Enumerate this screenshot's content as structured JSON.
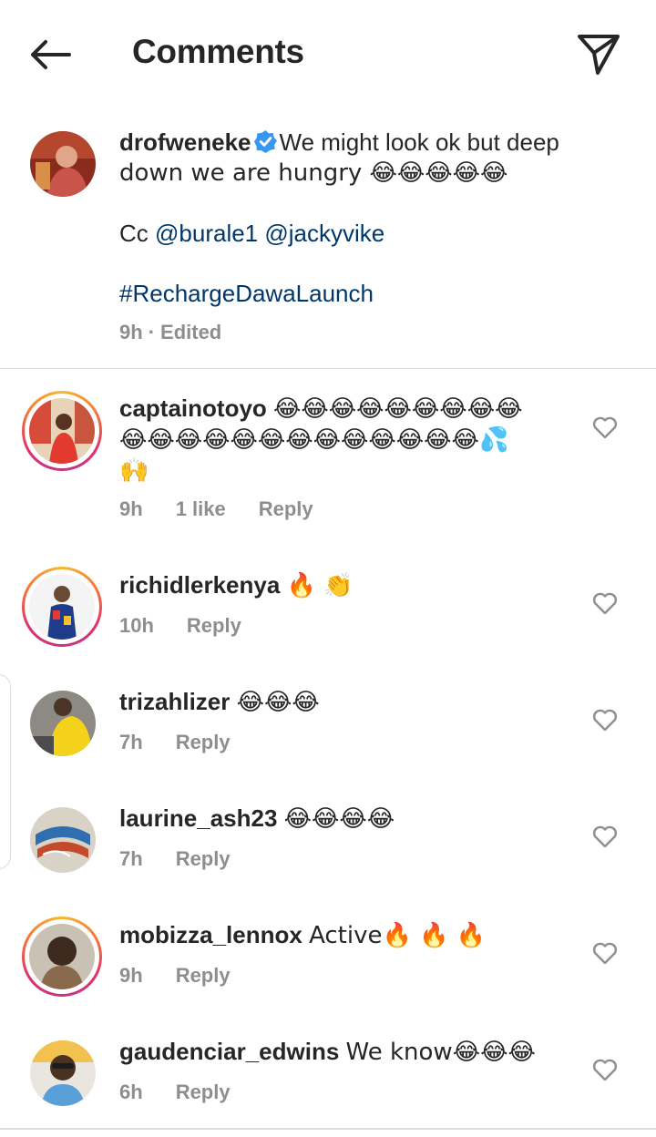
{
  "header": {
    "title": "Comments"
  },
  "caption": {
    "username": "drofweneke",
    "text_line1": "We might look ok but deep",
    "text_line2": "down we are hungry 😂😂😂😂😂",
    "cc_label": "Cc",
    "mention1": "@burale1",
    "mention2": "@jackyvike",
    "hashtag": "#RechargeDawaLaunch",
    "time": "9h",
    "separator": "·",
    "edited": "Edited"
  },
  "comments": [
    {
      "username": "captainotoyo",
      "line1": "😂😂😂😂😂😂😂😂😂",
      "line2": "😂😂😂😂😂😂😂😂😂😂😂😂😂💦",
      "line3": "🙌",
      "time": "9h",
      "likes": "1 like",
      "reply": "Reply"
    },
    {
      "username": "richidlerkenya",
      "text": "🔥 👏",
      "time": "10h",
      "reply": "Reply"
    },
    {
      "username": "trizahlizer",
      "text": "😂😂😂",
      "time": "7h",
      "reply": "Reply"
    },
    {
      "username": "laurine_ash23",
      "text": "😂😂😂😂",
      "time": "7h",
      "reply": "Reply"
    },
    {
      "username": "mobizza_lennox",
      "text": "Active🔥 🔥 🔥",
      "time": "9h",
      "reply": "Reply"
    },
    {
      "username": "gaudenciar_edwins",
      "text": "We know😂😂😂",
      "time": "6h",
      "reply": "Reply"
    }
  ],
  "colors": {
    "text": "#262626",
    "muted": "#8e8e8e",
    "link": "#00376b",
    "verified": "#3897f0",
    "divider": "#dbdbdb"
  },
  "icons": {
    "back": "arrow-left-icon",
    "send": "paper-plane-icon",
    "verified": "verified-badge-icon",
    "like": "heart-outline-icon"
  }
}
